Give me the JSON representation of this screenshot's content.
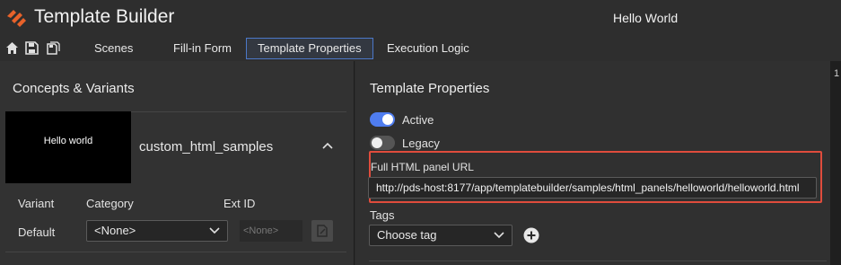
{
  "app": {
    "title": "Template Builder",
    "document_title": "Hello World",
    "accent": "#e8622a"
  },
  "toolbar": {
    "icons": [
      "home-icon",
      "save-icon",
      "save-as-icon"
    ],
    "tabs": [
      {
        "label": "Scenes",
        "active": false
      },
      {
        "label": "Fill-in Form",
        "active": false
      },
      {
        "label": "Template Properties",
        "active": true
      },
      {
        "label": "Execution Logic",
        "active": false
      }
    ]
  },
  "left_panel": {
    "title": "Concepts & Variants",
    "concept": {
      "thumbnail_text": "Hello world",
      "name": "custom_html_samples"
    },
    "variant_table": {
      "headers": [
        "Variant",
        "Category",
        "Ext ID"
      ],
      "row": {
        "variant": "Default",
        "category": "<None>",
        "ext_id_placeholder": "<None>"
      }
    }
  },
  "right_panel": {
    "title": "Template Properties",
    "active_label": "Active",
    "active_on": true,
    "legacy_label": "Legacy",
    "legacy_on": false,
    "url_label": "Full HTML panel URL",
    "url_value": "http://pds-host:8177/app/templatebuilder/samples/html_panels/helloworld/helloworld.html",
    "tags_label": "Tags",
    "tags_select": "Choose tag"
  },
  "edge_panel": {
    "text": "1"
  },
  "colors": {
    "highlight_border": "#e04c3c",
    "toggle_on": "#4f7df0",
    "active_tab_border": "#4c78c8"
  }
}
